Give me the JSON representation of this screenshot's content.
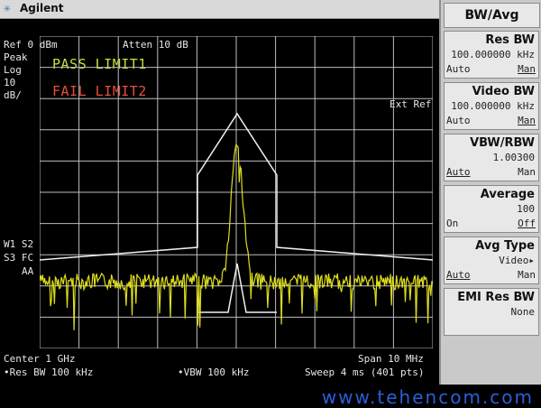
{
  "header": {
    "brand": "Agilent",
    "logo_icon": "agilent-spark-icon"
  },
  "readouts": {
    "ref": "Ref 0 dBm",
    "atten": "Atten 10 dB",
    "peak": "Peak",
    "log": "Log",
    "scale_value": "10",
    "scale_unit": "dB/",
    "ext_ref": "Ext Ref",
    "w1s2": "W1  S2",
    "s3fc": "S3  FC",
    "aa": "AA",
    "center": "Center 1 GHz",
    "res_bw": "•Res BW 100 kHz",
    "vbw": "•VBW 100 kHz",
    "span": "Span 10 MHz",
    "sweep": "Sweep 4 ms (401 pts)"
  },
  "limits": {
    "pass_text": "PASS LIMIT1",
    "fail_text": "FAIL LIMIT2",
    "pass_color": "#c8e038",
    "fail_color": "#e84f3a"
  },
  "trace": {
    "color": "#dede1e"
  },
  "menu": {
    "title": "BW/Avg",
    "keys": [
      {
        "label": "Res BW",
        "value": "100.000000 kHz",
        "left": "Auto",
        "right": "Man"
      },
      {
        "label": "Video BW",
        "value": "100.000000 kHz",
        "left": "Auto",
        "right": "Man"
      },
      {
        "label": "VBW/RBW",
        "value": "1.00300",
        "left": "Auto",
        "right": "Man"
      },
      {
        "label": "Average",
        "value": "100",
        "left": "On",
        "right": "Off"
      },
      {
        "label": "Avg Type",
        "value": "Video▸",
        "left": "Auto",
        "right": "Man"
      },
      {
        "label": "EMI Res BW",
        "value": "None",
        "left": "",
        "right": ""
      }
    ]
  },
  "watermark": "www.tehencom.com"
}
